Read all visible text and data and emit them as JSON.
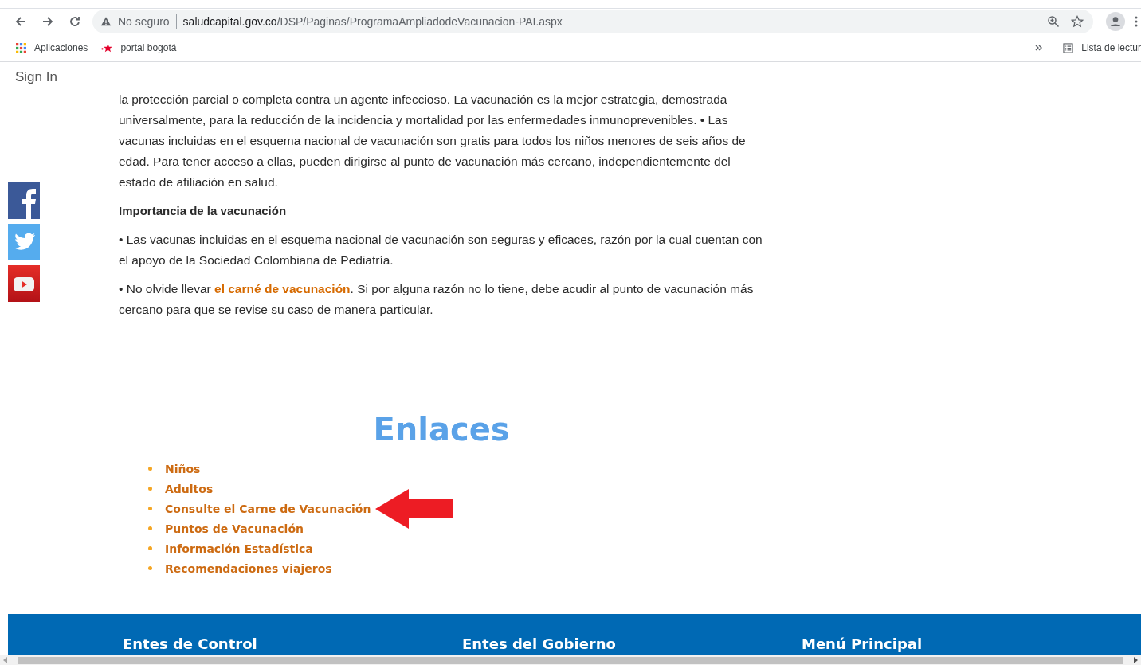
{
  "browser": {
    "security_label": "No seguro",
    "url_host": "saludcapital.gov.co",
    "url_path": "/DSP/Paginas/ProgramaAmpliadodeVacunacion-PAI.aspx",
    "bookmarks": [
      "Aplicaciones",
      "portal bogotá"
    ],
    "reading_list": "Lista de lectur"
  },
  "page": {
    "sign_in": "Sign In",
    "paragraphs": [
      {
        "kind": "text",
        "text": "la protección parcial o completa contra un agente infeccioso. La vacunación es la mejor estrategia, demostrada universalmente, para la reducción de la incidencia y mortalidad por las enfermedades inmunoprevenibles. • Las vacunas incluidas en el esquema nacional de vacunación son gratis para todos los niños menores de seis años de edad. Para tener acceso a ellas, pueden dirigirse al punto de vacunación más cercano, independientemente del estado de afiliación en salud."
      },
      {
        "kind": "heading",
        "text": "Importancia de la vacunación"
      },
      {
        "kind": "text",
        "text": "• Las vacunas incluidas en el esquema nacional de vacunación son seguras y eficaces, razón por la cual cuentan con el apoyo de la Sociedad Colombiana de Pediatría."
      },
      {
        "kind": "link_text",
        "before": "• No olvide llevar ",
        "link": "el carné de vacunación",
        "after": ". Si por alguna razón no lo tiene, debe acudir al punto de vacunación más cercano para que se revise su caso de manera particular."
      }
    ],
    "links_title": "Enlaces",
    "links": [
      {
        "label": "Niños",
        "underlined": false,
        "pointed": false
      },
      {
        "label": "Adultos",
        "underlined": false,
        "pointed": false
      },
      {
        "label": "Consulte el Carne de Vacunación",
        "underlined": true,
        "pointed": true
      },
      {
        "label": "Puntos de Vacunación",
        "underlined": false,
        "pointed": false
      },
      {
        "label": "Información Estadística",
        "underlined": false,
        "pointed": false
      },
      {
        "label": "Recomendaciones viajeros",
        "underlined": false,
        "pointed": false
      }
    ],
    "footer_headings": [
      "Entes de Control",
      "Entes del Gobierno",
      "Menú Principal"
    ]
  }
}
